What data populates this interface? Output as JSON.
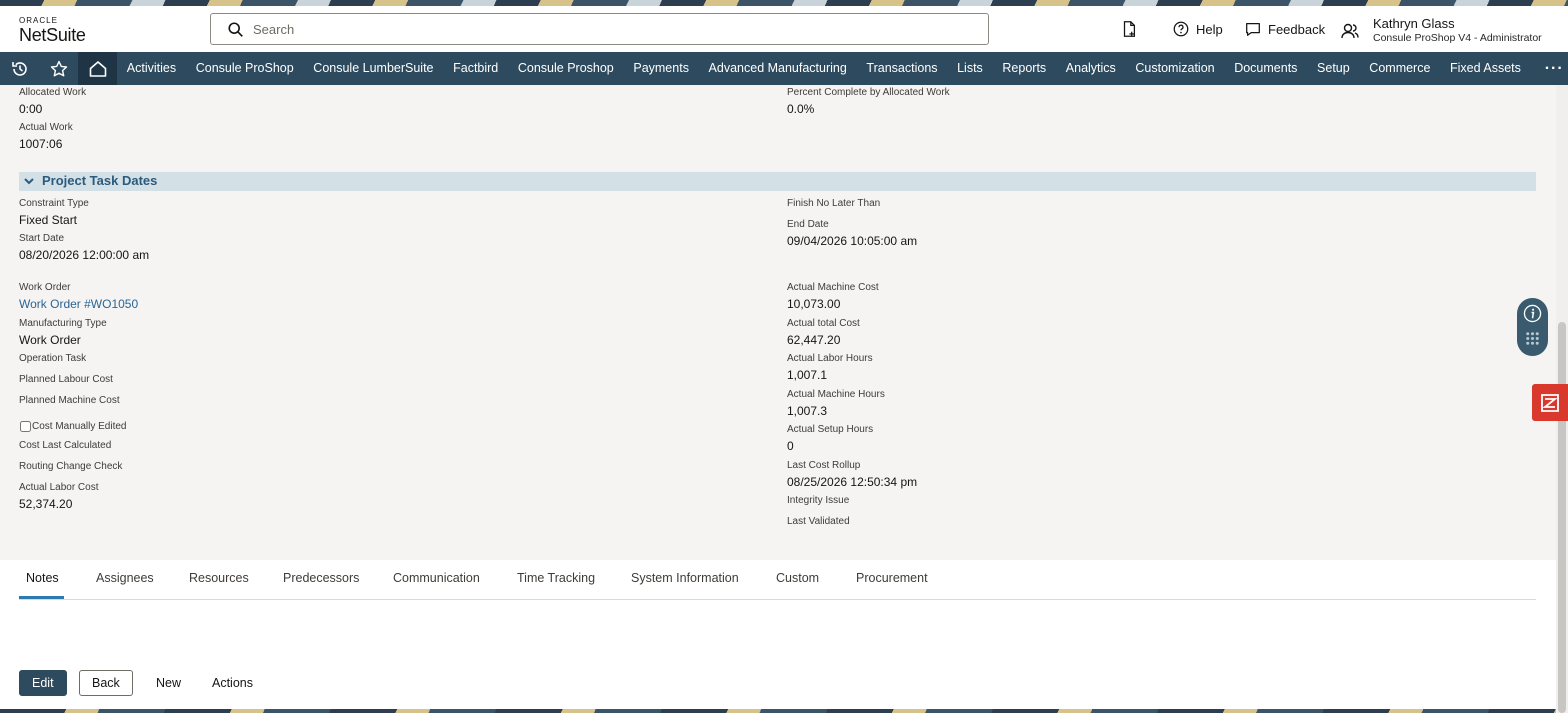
{
  "brand": {
    "oracle": "ORACLE",
    "netsuite": "NetSuite"
  },
  "search": {
    "placeholder": "Search"
  },
  "header": {
    "help": "Help",
    "feedback": "Feedback",
    "user_name": "Kathryn Glass",
    "user_role": "Consule ProShop V4 - Administrator"
  },
  "nav": {
    "items": [
      "Activities",
      "Consule ProShop",
      "Consule LumberSuite",
      "Factbird",
      "Consule Proshop",
      "Payments",
      "Advanced Manufacturing",
      "Transactions",
      "Lists",
      "Reports",
      "Analytics",
      "Customization",
      "Documents",
      "Setup",
      "Commerce",
      "Fixed Assets"
    ],
    "more": "···"
  },
  "top_fields": {
    "allocated_work_label": "Allocated Work",
    "allocated_work_value": "0:00",
    "actual_work_label": "Actual Work",
    "actual_work_value": "1007:06",
    "percent_complete_label": "Percent Complete by Allocated Work",
    "percent_complete_value": "0.0%"
  },
  "section": {
    "title": "Project Task Dates"
  },
  "dates": {
    "constraint_type_label": "Constraint Type",
    "constraint_type_value": "Fixed Start",
    "start_date_label": "Start Date",
    "start_date_value": "08/20/2026 12:00:00 am",
    "finish_no_later_label": "Finish No Later Than",
    "end_date_label": "End Date",
    "end_date_value": "09/04/2026 10:05:00 am"
  },
  "left_fields": {
    "work_order_label": "Work Order",
    "work_order_value": "Work Order #WO1050",
    "mfg_type_label": "Manufacturing Type",
    "mfg_type_value": "Work Order",
    "operation_task_label": "Operation Task",
    "planned_labour_label": "Planned Labour Cost",
    "planned_machine_label": "Planned Machine Cost",
    "cost_manually_edited_label": "Cost Manually Edited",
    "cost_last_calc_label": "Cost Last Calculated",
    "routing_change_label": "Routing Change Check",
    "actual_labor_cost_label": "Actual Labor Cost",
    "actual_labor_cost_value": "52,374.20"
  },
  "right_fields": {
    "actual_machine_cost_label": "Actual Machine Cost",
    "actual_machine_cost_value": "10,073.00",
    "actual_total_cost_label": "Actual total Cost",
    "actual_total_cost_value": "62,447.20",
    "actual_labor_hours_label": "Actual Labor Hours",
    "actual_labor_hours_value": "1,007.1",
    "actual_machine_hours_label": "Actual Machine Hours",
    "actual_machine_hours_value": "1,007.3",
    "actual_setup_hours_label": "Actual Setup Hours",
    "actual_setup_hours_value": "0",
    "last_cost_rollup_label": "Last Cost Rollup",
    "last_cost_rollup_value": "08/25/2026 12:50:34 pm",
    "integrity_issue_label": "Integrity Issue",
    "last_validated_label": "Last Validated"
  },
  "tabs": [
    "Notes",
    "Assignees",
    "Resources",
    "Predecessors",
    "Communication",
    "Time Tracking",
    "System Information",
    "Custom",
    "Procurement"
  ],
  "buttons": {
    "edit": "Edit",
    "back": "Back",
    "new": "New",
    "actions": "Actions"
  },
  "colors": {
    "nav_bg": "#2d4a5e",
    "section_bg": "#d3e1e6",
    "link": "#2a6595",
    "accent_red": "#d9382d"
  }
}
